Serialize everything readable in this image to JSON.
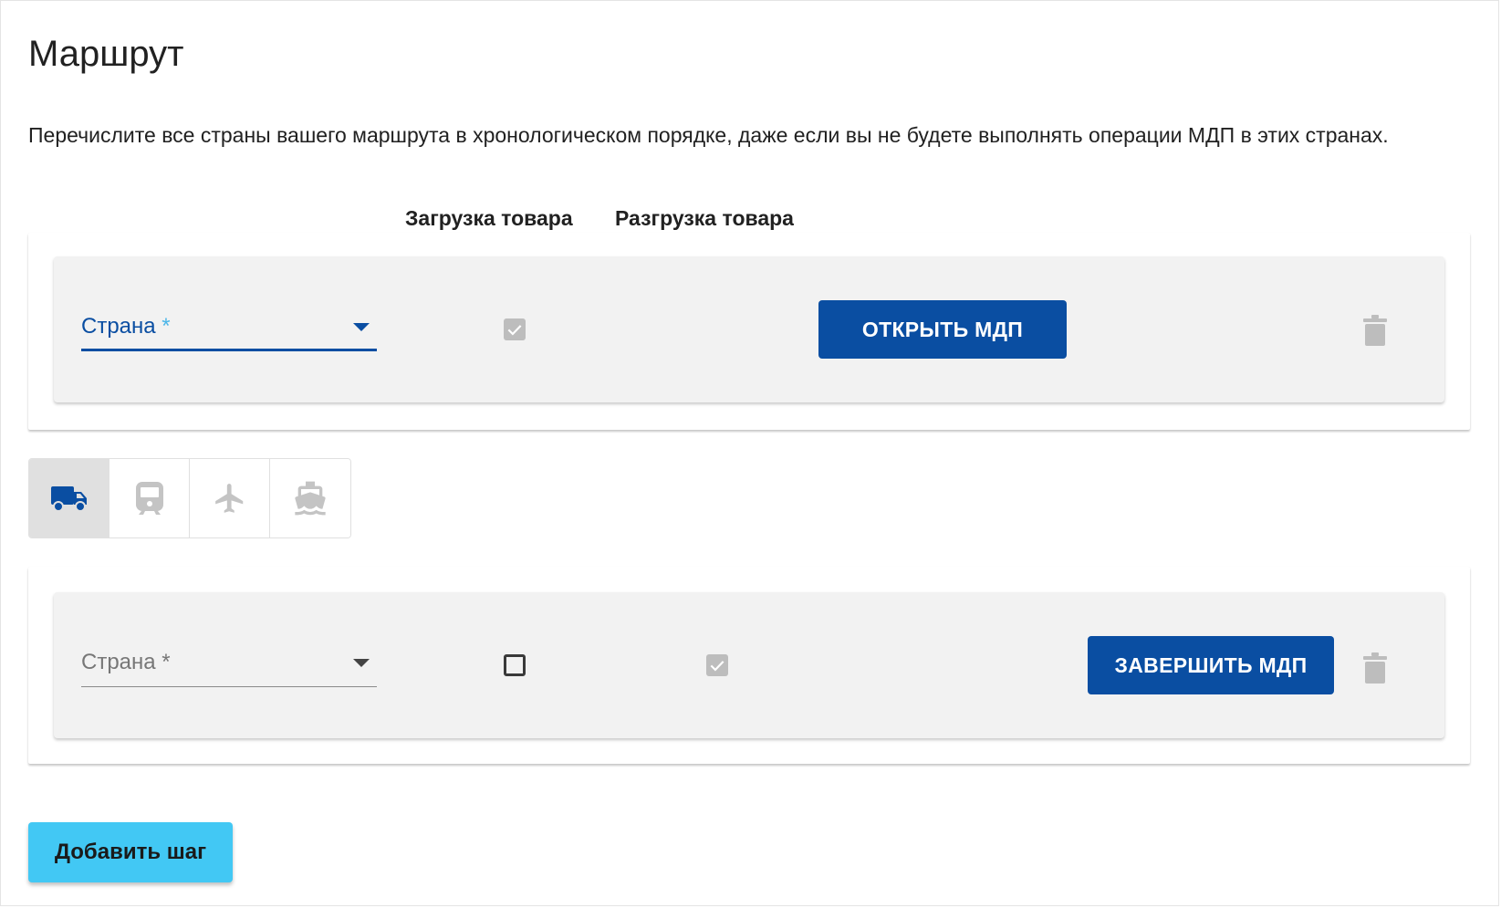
{
  "page": {
    "title": "Маршрут",
    "description": "Перечислите все страны вашего маршрута в хронологическом порядке, даже если вы не будете выполнять операции МДП в этих странах."
  },
  "columns": {
    "loading": "Загрузка товара",
    "unloading": "Разгрузка товара"
  },
  "steps": [
    {
      "country_label": "Страна",
      "required_mark": "*",
      "loading_checked": true,
      "action_label": "ОТКРЫТЬ МДП",
      "delete_icon": "trash-icon"
    },
    {
      "country_label": "Страна",
      "required_mark": "*",
      "loading_checked": false,
      "unloading_checked": true,
      "action_label": "ЗАВЕРШИТЬ МДП",
      "delete_icon": "trash-icon"
    }
  ],
  "transport_modes": [
    {
      "icon": "truck-icon",
      "selected": true
    },
    {
      "icon": "train-icon",
      "selected": false
    },
    {
      "icon": "airplane-icon",
      "selected": false
    },
    {
      "icon": "ship-icon",
      "selected": false
    }
  ],
  "actions": {
    "add_step_label": "Добавить шаг"
  },
  "colors": {
    "primary": "#0a4ea2",
    "accent": "#42c8f4",
    "card_bg": "#f2f2f2",
    "disabled": "#bdbdbd"
  }
}
